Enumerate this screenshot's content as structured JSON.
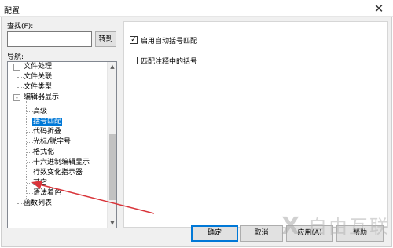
{
  "window": {
    "title": "配置",
    "close_glyph": "✕"
  },
  "find": {
    "label": "查找(F):",
    "value": "",
    "goto_label": "转到"
  },
  "nav": {
    "label": "导航:",
    "items": [
      {
        "label": "文件处理",
        "toggle": "+"
      },
      {
        "label": "文件关联"
      },
      {
        "label": "文件类型"
      },
      {
        "label": "编辑器显示",
        "toggle": "-"
      },
      {
        "label": "高级"
      },
      {
        "label": "括号匹配",
        "selected": true
      },
      {
        "label": "代码折叠"
      },
      {
        "label": "光标/脱字号"
      },
      {
        "label": "格式化"
      },
      {
        "label": "十六进制编辑显示"
      },
      {
        "label": "行数变化指示器"
      },
      {
        "label": "其它"
      },
      {
        "label": "语法着色"
      },
      {
        "label": "函数列表"
      }
    ]
  },
  "options": [
    {
      "label": "启用自动括号匹配",
      "checked": true
    },
    {
      "label": "匹配注释中的括号",
      "checked": false
    }
  ],
  "buttons": {
    "ok": "确定",
    "cancel": "取消",
    "apply": "应用(A)",
    "help": "帮助"
  },
  "watermark": {
    "text": "自由互联",
    "mark": "X"
  },
  "annotation": {
    "color": "#d9343a"
  },
  "checkmark_glyph": "✓"
}
